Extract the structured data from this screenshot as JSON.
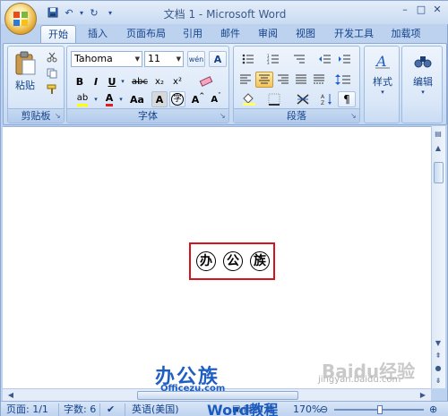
{
  "window": {
    "title": "文档 1 - Microsoft Word",
    "minimize": "–",
    "restore": "□",
    "close": "✕"
  },
  "quick_access": {
    "undo": "↶",
    "redo": "↻",
    "dropdown": "▾"
  },
  "tabs": [
    {
      "label": "开始",
      "active": true
    },
    {
      "label": "插入"
    },
    {
      "label": "页面布局"
    },
    {
      "label": "引用"
    },
    {
      "label": "邮件"
    },
    {
      "label": "审阅"
    },
    {
      "label": "视图"
    },
    {
      "label": "开发工具"
    },
    {
      "label": "加载项"
    }
  ],
  "ribbon": {
    "clipboard": {
      "label": "剪贴板",
      "paste": "粘贴"
    },
    "font": {
      "label": "字体",
      "font_name": "Tahoma",
      "font_size": "11",
      "bold": "B",
      "italic": "I",
      "underline": "U",
      "strike": "abc",
      "subscript": "x₂",
      "superscript": "x²",
      "clear": "Aa",
      "highlight": "ab",
      "font_color": "A",
      "change_case": "Aa",
      "char_shading": "A",
      "enclose": "字",
      "grow": "A",
      "shrink": "A",
      "phonetic": "wén",
      "char_border": "A"
    },
    "paragraph": {
      "label": "段落"
    },
    "styles": {
      "label": "样式"
    },
    "editing": {
      "label": "编辑"
    }
  },
  "document": {
    "chars": [
      "办",
      "公",
      "族"
    ]
  },
  "watermarks": {
    "brand": "办公族",
    "site": "Officezu.com",
    "word": "Word教程",
    "baidu": "Baidu经验",
    "baidu_url": "jingyan.baidu.com"
  },
  "status": {
    "page": "页面: 1/1",
    "words": "字数: 6",
    "lang": "英语(美国)",
    "zoom": "170%"
  },
  "colors": {
    "accent": "#15428b",
    "highlight_box": "#d4141c",
    "brand_blue": "#1f5fc4"
  }
}
